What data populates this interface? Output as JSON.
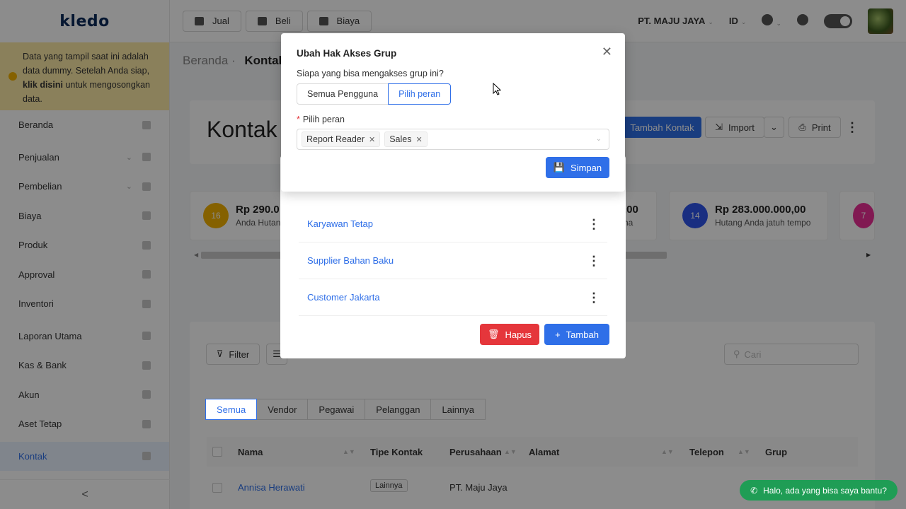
{
  "sidebar": {
    "logo": "kledo",
    "notice": {
      "text_before": "Data yang tampil saat ini adalah data dummy. Setelah Anda siap, ",
      "link": "klik disini",
      "text_after": " untuk mengosongkan data."
    },
    "items": [
      {
        "label": "Beranda",
        "icon": "home-icon"
      },
      {
        "label": "Penjualan",
        "icon": "basket-icon"
      },
      {
        "label": "Pembelian",
        "icon": "bag-icon"
      },
      {
        "label": "Biaya",
        "icon": "card-icon"
      },
      {
        "label": "Produk",
        "icon": "box-icon"
      },
      {
        "label": "Approval",
        "icon": "check-icon"
      },
      {
        "label": "Inventori",
        "icon": "warehouse-icon"
      },
      {
        "label": "Laporan Utama",
        "icon": "chart-icon"
      },
      {
        "label": "Kas & Bank",
        "icon": "dollar-icon"
      },
      {
        "label": "Akun",
        "icon": "book-icon"
      },
      {
        "label": "Aset Tetap",
        "icon": "building-icon"
      },
      {
        "label": "Kontak",
        "icon": "contacts-icon"
      }
    ],
    "collapse_glyph": "<"
  },
  "topbar": {
    "buttons": [
      {
        "label": "Jual",
        "icon": "basket-icon"
      },
      {
        "label": "Beli",
        "icon": "bag-icon"
      },
      {
        "label": "Biaya",
        "icon": "card-icon"
      }
    ],
    "company": "PT. MAJU JAYA",
    "language": "ID"
  },
  "main": {
    "breadcrumb_home": "Beranda",
    "breadcrumb_current": "Kontak",
    "title": "Kontak",
    "add_button": "Tambah Kontak",
    "import_button": "Import",
    "print_button": "Print",
    "stats": [
      {
        "count": "16",
        "amount": "Rp 290.0",
        "label": "Anda Hutan",
        "color": "#f2b100"
      },
      {
        "count": "",
        "amount": ",00",
        "label": "na",
        "color": "#ffffff"
      },
      {
        "count": "14",
        "amount": "Rp 283.000.000,00",
        "label": "Hutang Anda jatuh tempo",
        "color": "#2f54eb"
      },
      {
        "count": "7",
        "amount": "",
        "label": "",
        "color": "#eb2f96"
      }
    ],
    "filter_label": "Filter",
    "search_placeholder": "Cari",
    "tabs": [
      "Semua",
      "Vendor",
      "Pegawai",
      "Pelanggan",
      "Lainnya"
    ],
    "columns": [
      "Nama",
      "Tipe Kontak",
      "Perusahaan",
      "Alamat",
      "Telepon",
      "Grup"
    ],
    "rows": [
      {
        "nama": "Annisa Herawati",
        "tipe": "Lainnya",
        "perusahaan": "PT. Maju Jaya"
      }
    ]
  },
  "group_modal": {
    "groups": [
      "Karyawan Tetap",
      "Supplier Bahan Baku",
      "Customer Jakarta"
    ],
    "delete_button": "Hapus",
    "add_button": "Tambah"
  },
  "access_modal": {
    "title": "Ubah Hak Akses Grup",
    "question": "Siapa yang bisa mengakses grup ini?",
    "options": [
      "Semua Pengguna",
      "Pilih peran"
    ],
    "selected_option": "Pilih peran",
    "role_label": "Pilih peran",
    "selected_roles": [
      "Report Reader",
      "Sales"
    ],
    "save_button": "Simpan",
    "close_glyph": "✕"
  },
  "chat": {
    "label": "Halo, ada yang bisa saya bantu?"
  }
}
